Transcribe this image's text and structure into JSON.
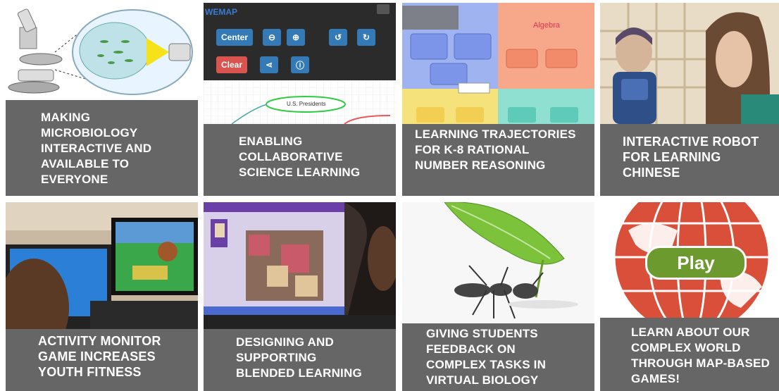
{
  "tiles": [
    {
      "id": "microbiology",
      "caption": "MAKING MICROBIOLOGY INTERACTIVE AND AVAILABLE TO EVERYONE"
    },
    {
      "id": "collaborative",
      "caption": "ENABLING COLLABORATIVE SCIENCE LEARNING"
    },
    {
      "id": "trajectories",
      "caption": "LEARNING TRAJECTORIES FOR K-8 RATIONAL NUMBER REASONING"
    },
    {
      "id": "robot",
      "caption": "INTERACTIVE ROBOT FOR LEARNING CHINESE"
    },
    {
      "id": "activity",
      "caption": "ACTIVITY MONITOR GAME INCREASES YOUTH FITNESS"
    },
    {
      "id": "blended",
      "caption": "DESIGNING AND SUPPORTING BLENDED LEARNING"
    },
    {
      "id": "biology",
      "caption": "GIVING STUDENTS FEEDBACK ON COMPLEX TASKS IN VIRTUAL BIOLOGY"
    },
    {
      "id": "mapgames",
      "caption": "LEARN ABOUT OUR COMPLEX WORLD THROUGH MAP-BASED GAMES!"
    }
  ],
  "wemap": {
    "logo": "WEMAP",
    "center_label": "Center",
    "clear_label": "Clear",
    "node_label": "U.S. Presidents"
  },
  "trajectories_image": {
    "section_label": "Algebra"
  },
  "map_game": {
    "play_label": "Play"
  },
  "colors": {
    "caption_bg": "#666666",
    "caption_text": "#ffffff",
    "wemap_bar": "#2b2b2b",
    "button_blue": "#337ab7",
    "button_red": "#d9534f",
    "play_green": "#6d9a2e",
    "globe_red": "#d94f3a"
  }
}
